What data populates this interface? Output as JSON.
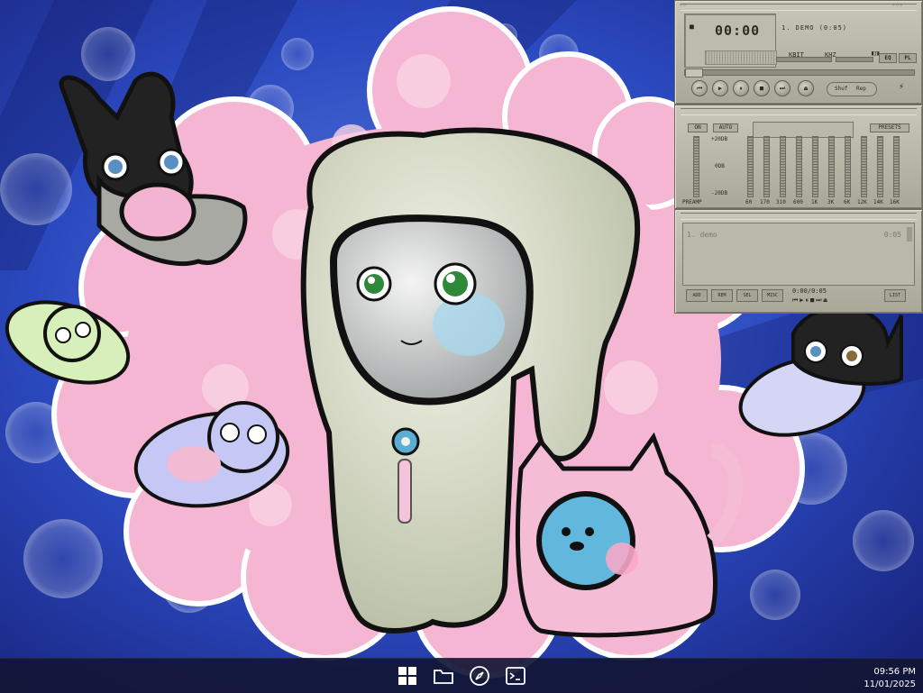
{
  "winamp": {
    "main": {
      "time": "00:00",
      "song": "1. DEMO (0:05)",
      "kbps_label": "KBIT",
      "khz_label": "KHZ",
      "eq_btn": "EQ",
      "pl_btn": "PL",
      "shuffle": "Shuf",
      "repeat": "Rep"
    },
    "eq": {
      "on": "ON",
      "auto": "AUTO",
      "presets": "PRESETS",
      "db_top": "+20DB",
      "db_mid": "0DB",
      "db_bot": "-20DB",
      "preamp": "PREAMP",
      "freqs": [
        "60",
        "170",
        "310",
        "600",
        "1K",
        "3K",
        "6K",
        "12K",
        "14K",
        "16K"
      ]
    },
    "playlist": {
      "item": "1. demo",
      "item_time": "0:05",
      "add": "ADD",
      "rem": "REM",
      "sel": "SEL",
      "misc": "MISC",
      "list": "LIST",
      "status_time": "0:00/0:05"
    }
  },
  "taskbar": {
    "icons": [
      "windows-start-icon",
      "folder-icon",
      "compass-icon",
      "terminal-icon"
    ],
    "clock_time": "09:56 PM",
    "clock_date": "11/01/2025"
  },
  "colors": {
    "accent_blue": "#2a47b7",
    "pink": "#f5b6d0",
    "winamp_gray": "#b8b6a6",
    "taskbar": "#121634"
  }
}
